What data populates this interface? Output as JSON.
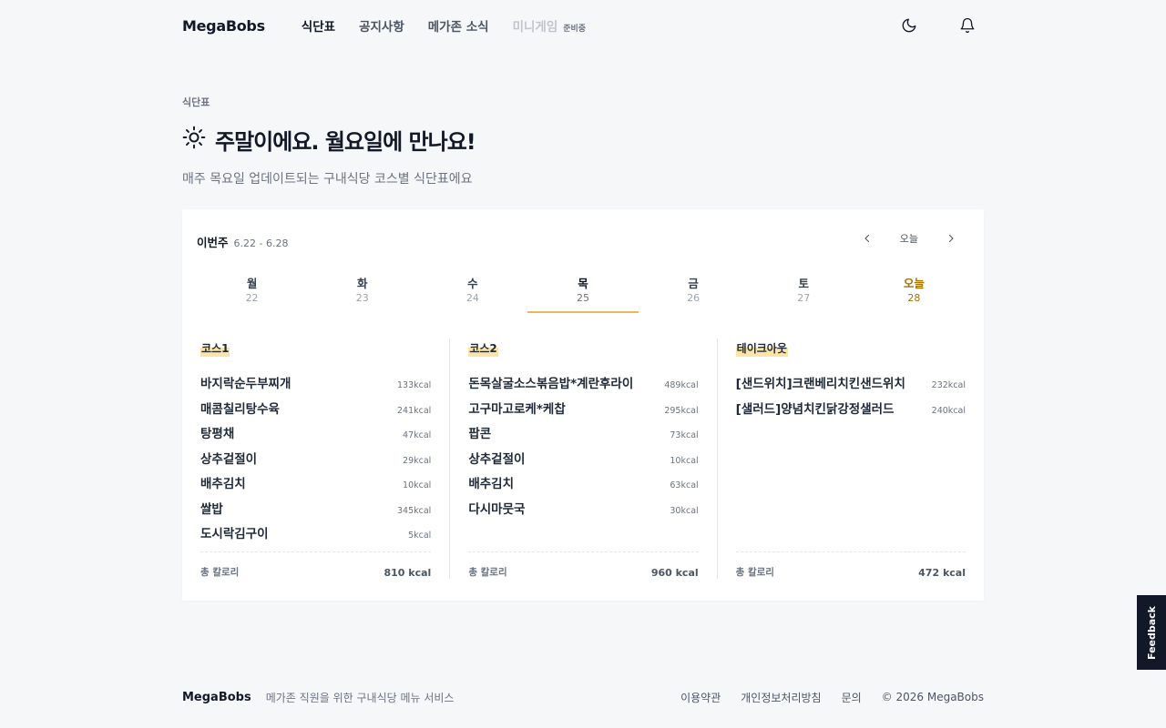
{
  "header": {
    "logo": "MegaBobs",
    "nav": [
      {
        "label": "식단표",
        "active": true
      },
      {
        "label": "공지사항"
      },
      {
        "label": "메가존 소식"
      },
      {
        "label": "미니게임",
        "badge": "준비중",
        "disabled": true
      }
    ],
    "icons": [
      "moon-icon",
      "bell-icon"
    ]
  },
  "section_label": "식단표",
  "title": "주말이에요. 월요일에 만나요!",
  "title_icon": "sun-icon",
  "subtitle": "매주 목요일 업데이트되는 구내식당 코스별 식단표에요",
  "week": {
    "label": "이번주",
    "range": "6.22 - 6.28",
    "today_button": "오늘"
  },
  "days": [
    {
      "name": "월",
      "num": "22"
    },
    {
      "name": "화",
      "num": "23"
    },
    {
      "name": "수",
      "num": "24"
    },
    {
      "name": "목",
      "num": "25",
      "selected": true
    },
    {
      "name": "금",
      "num": "26"
    },
    {
      "name": "토",
      "num": "27"
    },
    {
      "name": "오늘",
      "num": "28",
      "today": true
    }
  ],
  "courses": [
    {
      "title": "코스1",
      "items": [
        {
          "name": "바지락순두부찌개",
          "kcal": "133kcal"
        },
        {
          "name": "매콤칠리탕수육",
          "kcal": "241kcal"
        },
        {
          "name": "탕평채",
          "kcal": "47kcal"
        },
        {
          "name": "상추겉절이",
          "kcal": "29kcal"
        },
        {
          "name": "배추김치",
          "kcal": "10kcal"
        },
        {
          "name": "쌀밥",
          "kcal": "345kcal"
        },
        {
          "name": "도시락김구이",
          "kcal": "5kcal"
        }
      ],
      "total_label": "총 칼로리",
      "total": "810 kcal"
    },
    {
      "title": "코스2",
      "items": [
        {
          "name": "돈목살굴소스볶음밥*계란후라이",
          "kcal": "489kcal"
        },
        {
          "name": "고구마고로케*케찹",
          "kcal": "295kcal"
        },
        {
          "name": "팝콘",
          "kcal": "73kcal"
        },
        {
          "name": "상추겉절이",
          "kcal": "10kcal"
        },
        {
          "name": "배추김치",
          "kcal": "63kcal"
        },
        {
          "name": "다시마뭇국",
          "kcal": "30kcal"
        }
      ],
      "total_label": "총 칼로리",
      "total": "960 kcal"
    },
    {
      "title": "테이크아웃",
      "items": [
        {
          "name": "[샌드위치]크랜베리치킨샌드위치",
          "kcal": "232kcal"
        },
        {
          "name": "[샐러드]양념치킨닭강정샐러드",
          "kcal": "240kcal"
        }
      ],
      "total_label": "총 칼로리",
      "total": "472 kcal"
    }
  ],
  "footer": {
    "logo": "MegaBobs",
    "desc": "메가존 직원을 위한 구내식당 메뉴 서비스",
    "links": [
      "이용약관",
      "개인정보처리방침",
      "문의"
    ],
    "copyright": "© 2026 MegaBobs"
  },
  "feedback_label": "Feedback",
  "colors": {
    "background": "#f6f7f9",
    "accent_underline": "#e8b85a",
    "highlight": "#fbe4a6",
    "today": "#a47300",
    "feedback_bg": "#111827"
  }
}
